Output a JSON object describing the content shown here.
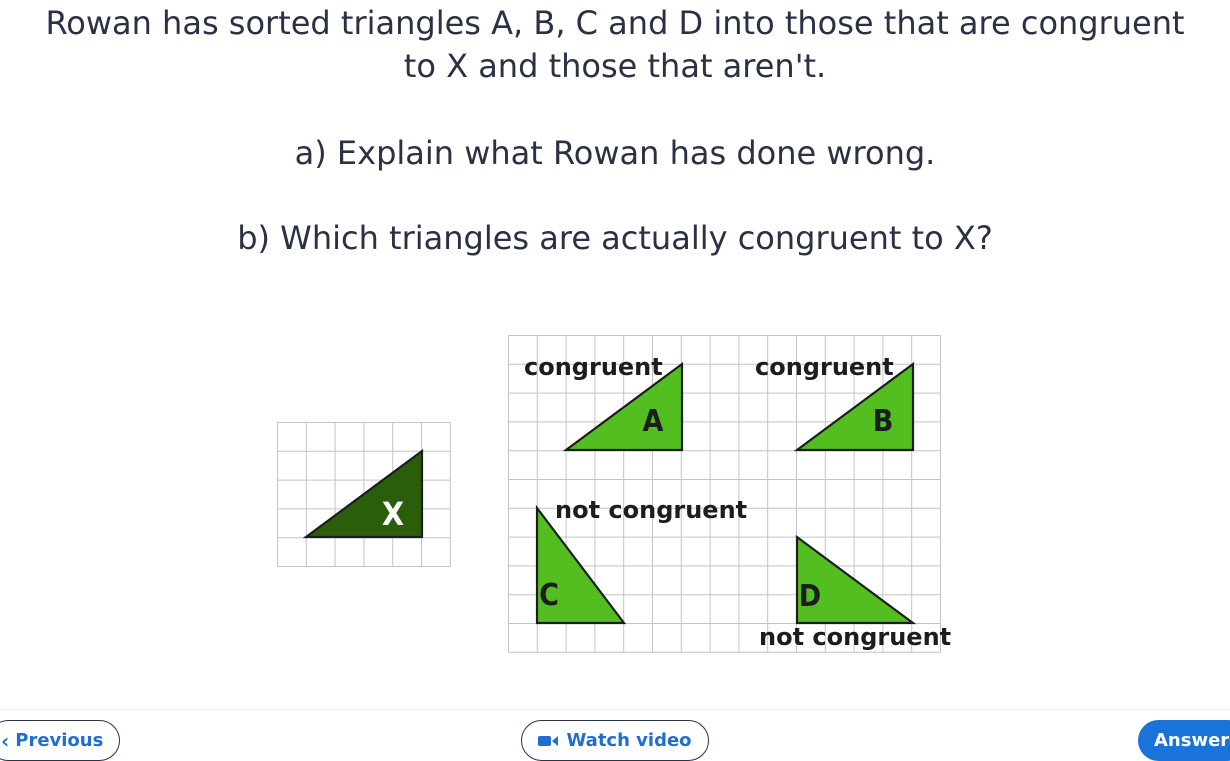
{
  "question": {
    "intro_line1": "Rowan has sorted triangles A, B, C and D into those that are congruent",
    "intro_line2": "to X and those that aren't.",
    "part_a": "a) Explain what Rowan has done wrong.",
    "part_b": "b) Which triangles are actually congruent to X?"
  },
  "figure": {
    "reference_triangle": {
      "label": "X",
      "color": "#2a5e0b"
    },
    "triangles": [
      {
        "label": "A",
        "sort_label": "congruent",
        "color": "#52be1f"
      },
      {
        "label": "B",
        "sort_label": "congruent",
        "color": "#52be1f"
      },
      {
        "label": "C",
        "sort_label": "not congruent",
        "color": "#52be1f"
      },
      {
        "label": "D",
        "sort_label": "not congruent",
        "color": "#52be1f"
      }
    ]
  },
  "footer": {
    "previous_label": "Previous",
    "previous_icon": "chevron-left-icon",
    "watch_video_label": "Watch video",
    "watch_video_icon": "video-camera-icon",
    "answer_label": "Answer",
    "answer_color": "#1a73d9"
  }
}
